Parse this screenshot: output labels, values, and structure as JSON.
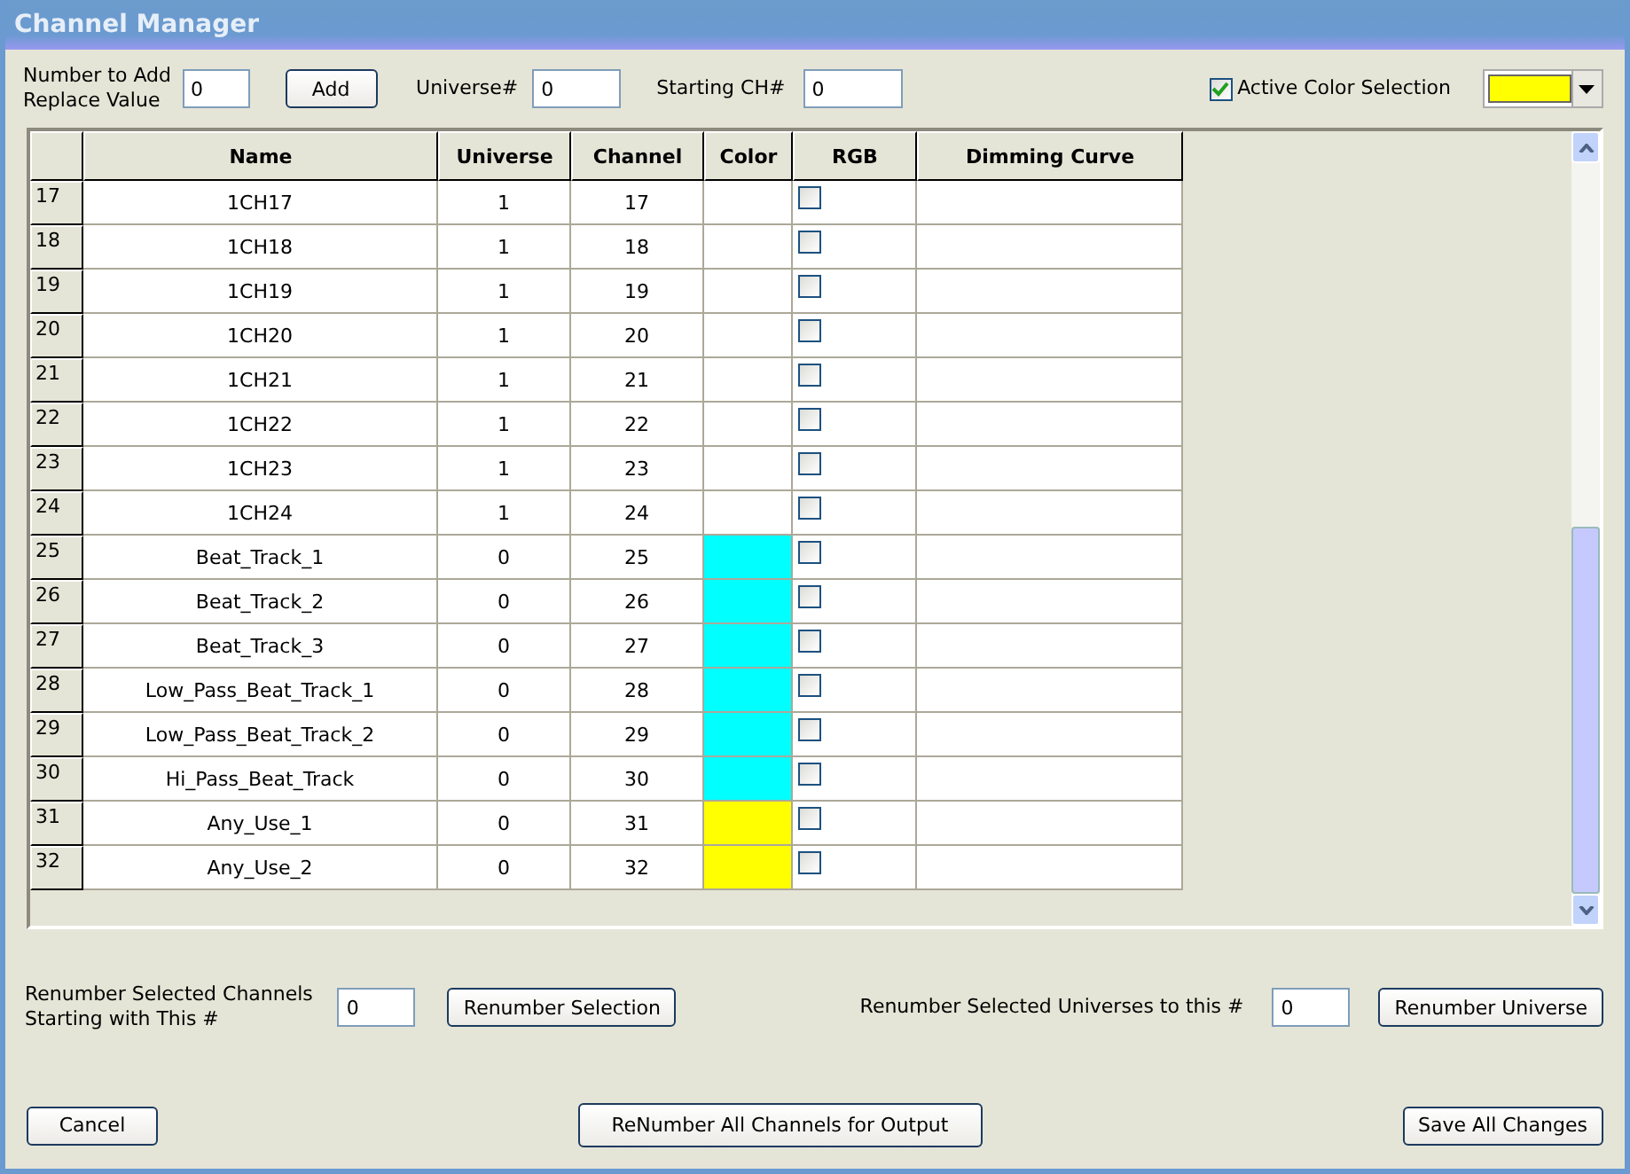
{
  "window": {
    "title": "Channel Manager"
  },
  "toolbar": {
    "number_label": "Number to Add\nReplace Value",
    "number_value": "0",
    "add_button": "Add",
    "universe_label": "Universe#",
    "universe_value": "0",
    "start_label": "Starting CH#",
    "start_value": "0",
    "active_color": {
      "label": "Active Color Selection",
      "checked": true,
      "color": "#ffff00"
    }
  },
  "table": {
    "columns": [
      "Name",
      "Universe",
      "Channel",
      "Color",
      "RGB",
      "Dimming Curve"
    ],
    "rows": [
      {
        "index": "17",
        "name": "1CH17",
        "universe": "1",
        "channel": "17",
        "rgb": false
      },
      {
        "index": "18",
        "name": "1CH18",
        "universe": "1",
        "channel": "18",
        "rgb": false
      },
      {
        "index": "19",
        "name": "1CH19",
        "universe": "1",
        "channel": "19",
        "rgb": false
      },
      {
        "index": "20",
        "name": "1CH20",
        "universe": "1",
        "channel": "20",
        "rgb": false
      },
      {
        "index": "21",
        "name": "1CH21",
        "universe": "1",
        "channel": "21",
        "rgb": false
      },
      {
        "index": "22",
        "name": "1CH22",
        "universe": "1",
        "channel": "22",
        "rgb": false
      },
      {
        "index": "23",
        "name": "1CH23",
        "universe": "1",
        "channel": "23",
        "rgb": false
      },
      {
        "index": "24",
        "name": "1CH24",
        "universe": "1",
        "channel": "24",
        "rgb": false
      },
      {
        "index": "25",
        "name": "Beat_Track_1",
        "universe": "0",
        "channel": "25",
        "color": "#00ffff",
        "rgb": false
      },
      {
        "index": "26",
        "name": "Beat_Track_2",
        "universe": "0",
        "channel": "26",
        "color": "#00ffff",
        "rgb": false
      },
      {
        "index": "27",
        "name": "Beat_Track_3",
        "universe": "0",
        "channel": "27",
        "color": "#00ffff",
        "rgb": false
      },
      {
        "index": "28",
        "name": "Low_Pass_Beat_Track_1",
        "universe": "0",
        "channel": "28",
        "color": "#00ffff",
        "rgb": false
      },
      {
        "index": "29",
        "name": "Low_Pass_Beat_Track_2",
        "universe": "0",
        "channel": "29",
        "color": "#00ffff",
        "rgb": false
      },
      {
        "index": "30",
        "name": "Hi_Pass_Beat_Track",
        "universe": "0",
        "channel": "30",
        "color": "#00ffff",
        "rgb": false
      },
      {
        "index": "31",
        "name": "Any_Use_1",
        "universe": "0",
        "channel": "31",
        "color": "#ffff00",
        "rgb": false
      },
      {
        "index": "32",
        "name": "Any_Use_2",
        "universe": "0",
        "channel": "32",
        "color": "#ffff00",
        "rgb": false
      }
    ]
  },
  "renumber": {
    "channels_label": "Renumber Selected Channels\nStarting with This #",
    "channels_value": "0",
    "channels_button": "Renumber Selection",
    "universes_label": "Renumber Selected Universes to this #",
    "universes_value": "0",
    "universes_button": "Renumber Universe"
  },
  "footer": {
    "cancel": "Cancel",
    "renumber_all": "ReNumber All Channels for Output",
    "save": "Save All Changes"
  }
}
